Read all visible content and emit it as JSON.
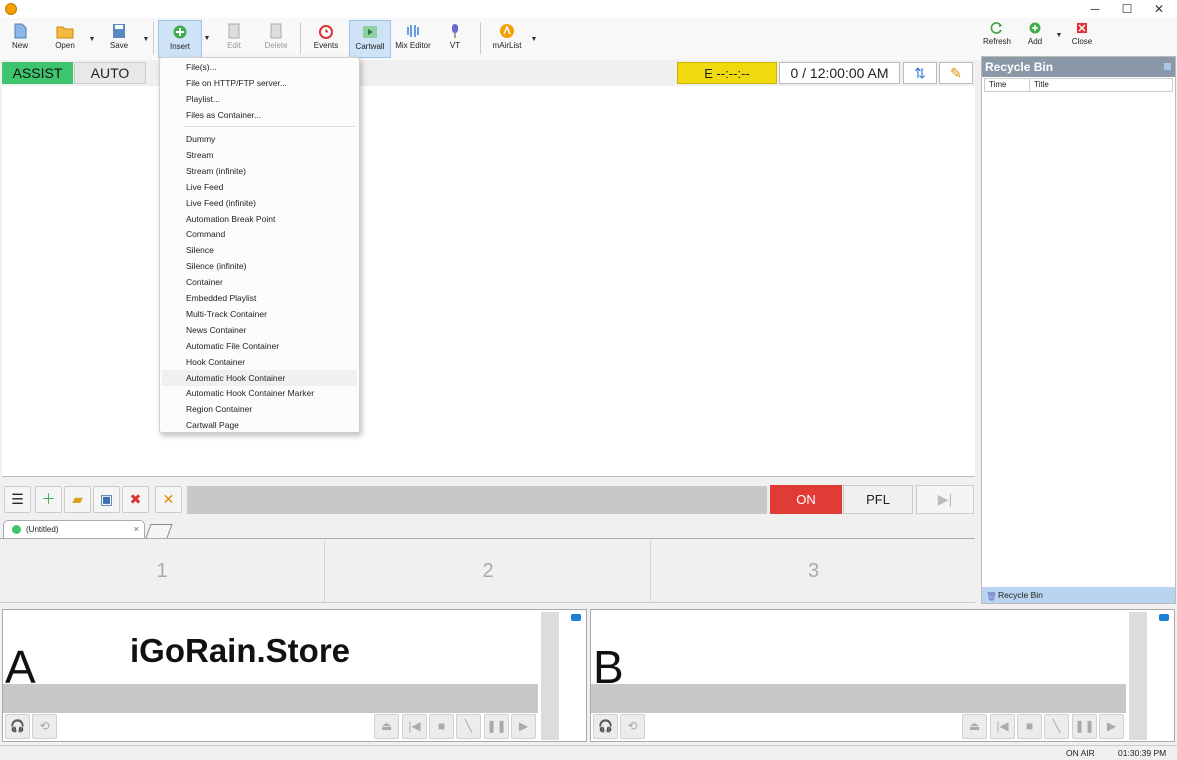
{
  "toolbar": {
    "new": "New",
    "open": "Open",
    "save": "Save",
    "insert": "Insert",
    "edit": "Edit",
    "delete": "Delete",
    "events": "Events",
    "cartwall": "Cartwall",
    "mix_editor": "Mix Editor",
    "vt": "VT",
    "mairlist": "mAirList",
    "refresh": "Refresh",
    "add": "Add",
    "close": "Close"
  },
  "modebar": {
    "assist": "ASSIST",
    "auto": "AUTO",
    "timer_e": "E  --:--:--",
    "clock": "0 / 12:00:00 AM"
  },
  "insert_menu": {
    "group1": [
      "File(s)...",
      "File on HTTP/FTP server...",
      "Playlist...",
      "Files as Container..."
    ],
    "group2": [
      "Dummy",
      "Stream",
      "Stream (infinite)",
      "Live Feed",
      "Live Feed (infinite)",
      "Automation Break Point",
      "Command",
      "Silence",
      "Silence (infinite)",
      "Container",
      "Embedded Playlist",
      "Multi-Track Container",
      "News Container",
      "Automatic File Container",
      "Hook Container",
      "Automatic Hook Container",
      "Automatic Hook Container Marker",
      "Region Container",
      "Cartwall Page"
    ],
    "highlighted": "Automatic Hook Container"
  },
  "cart": {
    "on": "ON",
    "pfl": "PFL",
    "tab_label": "(Untitled)",
    "slots": [
      "1",
      "2",
      "3"
    ]
  },
  "recycle_bin": {
    "title": "Recycle Bin",
    "col_time": "Time",
    "col_title": "Title",
    "footer": "Recycle Bin"
  },
  "players": {
    "a_label": "A",
    "b_label": "B"
  },
  "watermark": "iGoRain.Store",
  "status": {
    "on_air": "ON AIR",
    "time": "01:30:39 PM"
  }
}
